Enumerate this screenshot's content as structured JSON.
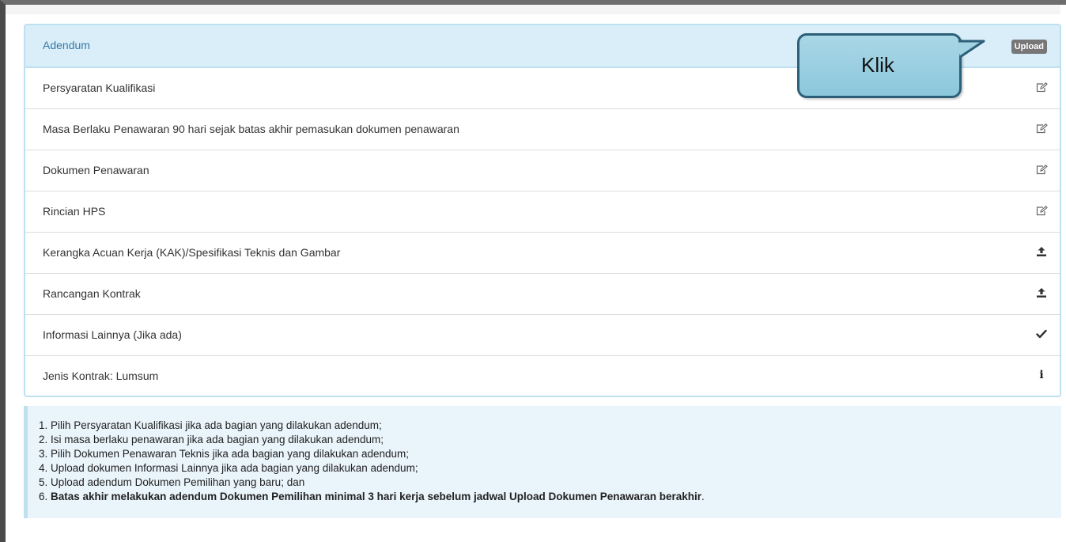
{
  "panel": {
    "title": "Adendum",
    "upload_badge": "Upload"
  },
  "rows": [
    {
      "label": "Persyaratan Kualifikasi",
      "icon": "edit-icon"
    },
    {
      "label": "Masa Berlaku Penawaran 90 hari sejak batas akhir pemasukan dokumen penawaran",
      "icon": "edit-icon"
    },
    {
      "label": "Dokumen Penawaran",
      "icon": "edit-icon"
    },
    {
      "label": "Rincian HPS",
      "icon": "edit-icon"
    },
    {
      "label": "Kerangka Acuan Kerja (KAK)/Spesifikasi Teknis dan Gambar",
      "icon": "upload-icon"
    },
    {
      "label": "Rancangan Kontrak",
      "icon": "upload-icon"
    },
    {
      "label": "Informasi Lainnya (Jika ada)",
      "icon": "check-icon"
    },
    {
      "label": "Jenis Kontrak: Lumsum",
      "icon": "info-icon"
    }
  ],
  "callout": {
    "text": "Klik"
  },
  "notes": {
    "line1": "1. Pilih Persyaratan Kualifikasi jika ada bagian yang dilakukan adendum;",
    "line2": "2. Isi masa berlaku penawaran jika ada bagian yang dilakukan adendum;",
    "line3": "3. Pilih Dokumen Penawaran Teknis jika ada bagian yang dilakukan adendum;",
    "line4": "4. Upload dokumen Informasi Lainnya jika ada bagian yang dilakukan adendum;",
    "line5": "5. Upload adendum Dokumen Pemilihan yang baru; dan",
    "line6_prefix": "6. ",
    "line6_bold": "Batas akhir melakukan adendum Dokumen Pemilihan minimal 3 hari kerja sebelum jadwal Upload Dokumen Penawaran berakhir",
    "line6_suffix": "."
  },
  "colors": {
    "heading_bg": "#d9eef8",
    "title_text": "#3879a8",
    "badge_bg": "#777777",
    "callout_fill": "#a9d7e6",
    "callout_border": "#2c5f78",
    "notes_bg": "#eaf4fb"
  }
}
